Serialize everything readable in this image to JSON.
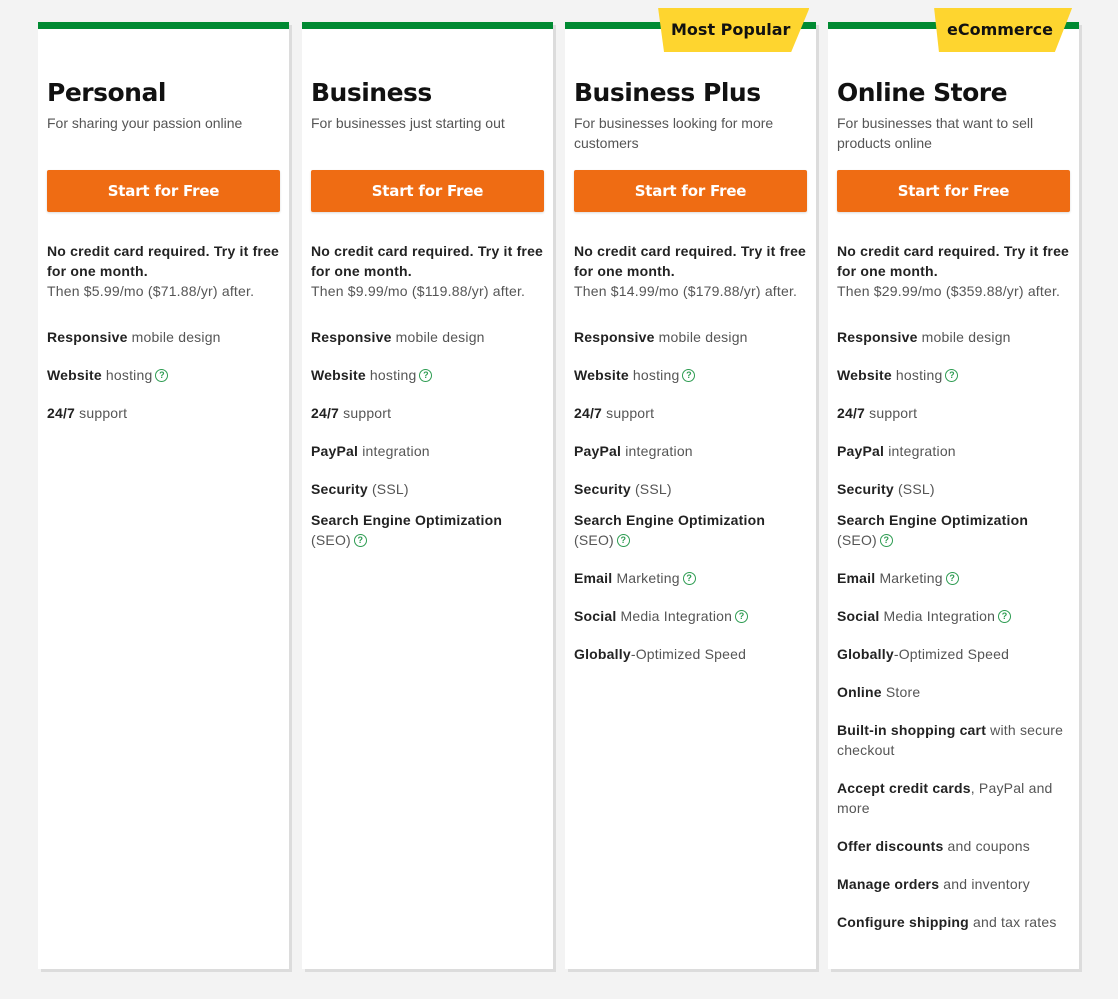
{
  "plans": [
    {
      "name": "Personal",
      "description": "For sharing your passion online",
      "cta": "Start for Free",
      "trial_bold": "No credit card required. Try it free for one month.",
      "trial_price": "Then $5.99/mo ($71.88/yr) after.",
      "features": [
        {
          "bold": "Responsive",
          "rest": " mobile design",
          "help": false
        },
        {
          "bold": "Website",
          "rest": " hosting",
          "help": true
        },
        {
          "bold": "24/7",
          "rest": " support",
          "help": false
        }
      ]
    },
    {
      "name": "Business",
      "description": "For businesses just starting out",
      "cta": "Start for Free",
      "trial_bold": "No credit card required. Try it free for one month.",
      "trial_price": "Then $9.99/mo ($119.88/yr) after.",
      "features": [
        {
          "bold": "Responsive",
          "rest": " mobile design",
          "help": false
        },
        {
          "bold": "Website",
          "rest": " hosting",
          "help": true
        },
        {
          "bold": "24/7",
          "rest": " support",
          "help": false
        },
        {
          "bold": "PayPal",
          "rest": " integration",
          "help": false
        },
        {
          "bold": "Security",
          "rest": " (SSL)",
          "help": false
        },
        {
          "bold": "Search Engine Optimization",
          "rest": " (SEO)",
          "help": true,
          "tight": true
        }
      ]
    },
    {
      "name": "Business Plus",
      "badge": "Most Popular",
      "description": "For businesses looking for more customers",
      "cta": "Start for Free",
      "trial_bold": "No credit card required. Try it free for one month.",
      "trial_price": "Then $14.99/mo ($179.88/yr) after.",
      "features": [
        {
          "bold": "Responsive",
          "rest": " mobile design",
          "help": false
        },
        {
          "bold": "Website",
          "rest": " hosting",
          "help": true
        },
        {
          "bold": "24/7",
          "rest": " support",
          "help": false
        },
        {
          "bold": "PayPal",
          "rest": " integration",
          "help": false
        },
        {
          "bold": "Security",
          "rest": " (SSL)",
          "help": false
        },
        {
          "bold": "Search Engine Optimization",
          "rest": " (SEO)",
          "help": true,
          "tight": true
        },
        {
          "bold": "Email",
          "rest": " Marketing",
          "help": true
        },
        {
          "bold": "Social",
          "rest": " Media Integration",
          "help": true
        },
        {
          "bold": "Globally",
          "rest": "-Optimized Speed",
          "help": false
        }
      ]
    },
    {
      "name": "Online Store",
      "badge": "eCommerce",
      "description": "For businesses that want to sell products online",
      "cta": "Start for Free",
      "trial_bold": "No credit card required. Try it free for one month.",
      "trial_price": "Then $29.99/mo ($359.88/yr) after.",
      "features": [
        {
          "bold": "Responsive",
          "rest": " mobile design",
          "help": false
        },
        {
          "bold": "Website",
          "rest": " hosting",
          "help": true
        },
        {
          "bold": "24/7",
          "rest": " support",
          "help": false
        },
        {
          "bold": "PayPal",
          "rest": " integration",
          "help": false
        },
        {
          "bold": "Security",
          "rest": " (SSL)",
          "help": false
        },
        {
          "bold": "Search Engine Optimization",
          "rest": " (SEO)",
          "help": true,
          "tight": true
        },
        {
          "bold": "Email",
          "rest": " Marketing",
          "help": true
        },
        {
          "bold": "Social",
          "rest": " Media Integration",
          "help": true
        },
        {
          "bold": "Globally",
          "rest": "-Optimized Speed",
          "help": false
        },
        {
          "bold": "Online",
          "rest": " Store",
          "help": false
        },
        {
          "bold": "Built-in shopping cart",
          "rest": " with secure checkout",
          "help": false
        },
        {
          "bold": "Accept credit cards",
          "rest": ", PayPal and more",
          "help": false
        },
        {
          "bold": "Offer discounts",
          "rest": " and coupons",
          "help": false
        },
        {
          "bold": "Manage orders",
          "rest": " and inventory",
          "help": false
        },
        {
          "bold": "Configure shipping",
          "rest": " and tax rates",
          "help": false
        }
      ]
    }
  ],
  "help_glyph": "?",
  "colors": {
    "accent_green": "#008a32",
    "cta_orange": "#ef6c13",
    "badge_yellow": "#fed52f"
  }
}
